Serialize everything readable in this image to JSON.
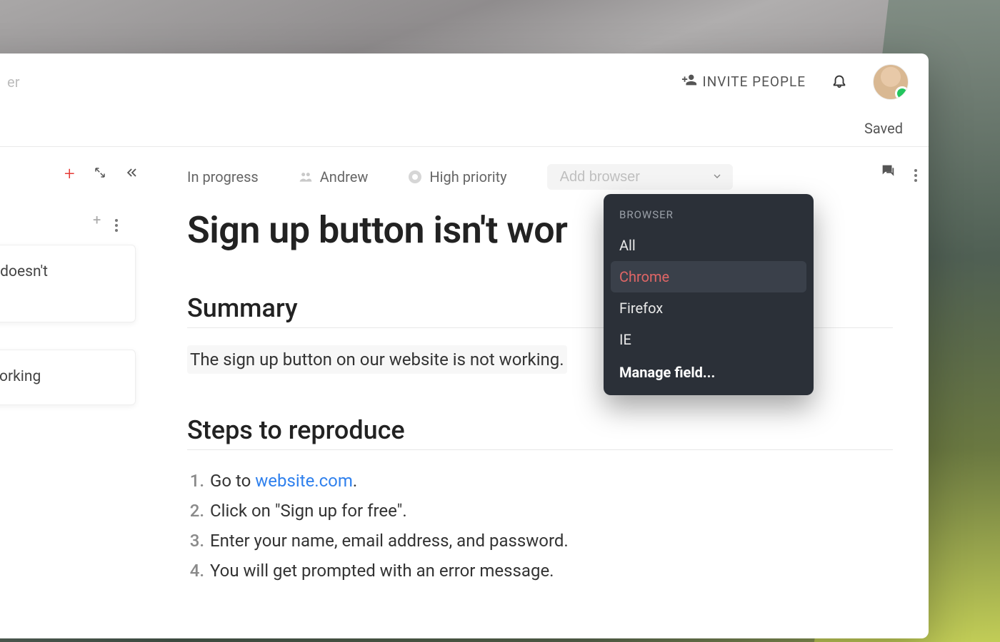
{
  "topbar": {
    "breadcrumb_truncated": "er",
    "invite_label": "INVITE PEOPLE",
    "saved_label": "Saved"
  },
  "sidebar": {
    "cards": [
      {
        "text": "board doesn't\ntically"
      },
      {
        "text": "isn't working"
      }
    ]
  },
  "meta": {
    "status": "In progress",
    "assignee": "Andrew",
    "priority": "High priority",
    "browser_placeholder": "Add browser"
  },
  "document": {
    "title": "Sign up button isn't wor",
    "summary_heading": "Summary",
    "summary_text": "The sign up button on our website is not working.",
    "steps_heading": "Steps to reproduce",
    "steps": [
      {
        "prefix": "Go to ",
        "link": "website.com",
        "suffix": "."
      },
      {
        "text": "Click on \"Sign up for free\"."
      },
      {
        "text": "Enter your name, email address, and password."
      },
      {
        "text": "You will get prompted with an error message."
      }
    ]
  },
  "popover": {
    "header": "BROWSER",
    "options": [
      "All",
      "Chrome",
      "Firefox",
      "IE"
    ],
    "selected": "Chrome",
    "manage_label": "Manage field..."
  }
}
